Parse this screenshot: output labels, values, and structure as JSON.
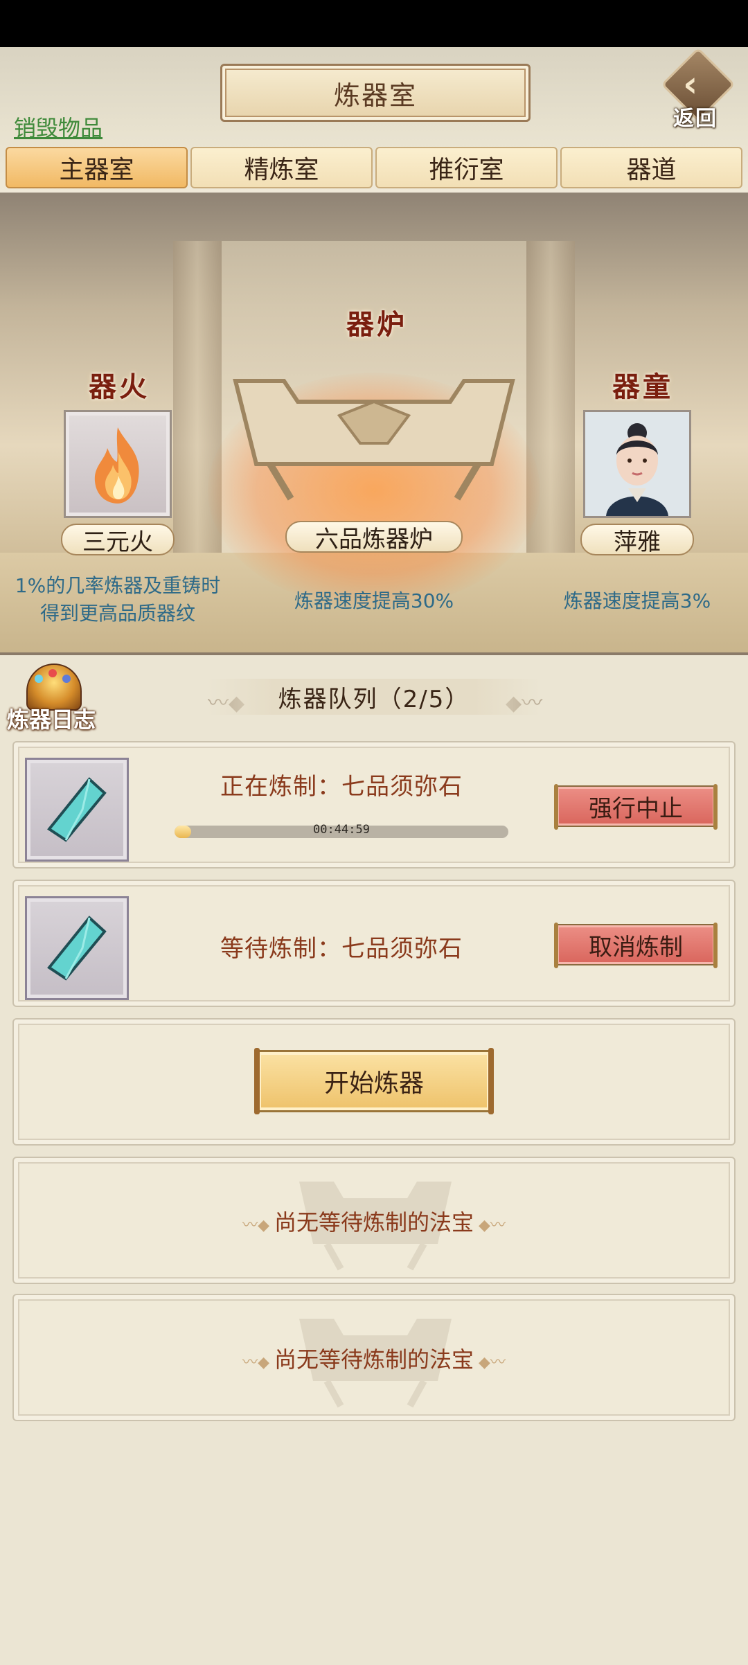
{
  "header": {
    "title": "炼器室",
    "back_label": "返回",
    "destroy_link": "销毁物品"
  },
  "tabs": [
    {
      "label": "主器室",
      "active": true
    },
    {
      "label": "精炼室",
      "active": false
    },
    {
      "label": "推衍室",
      "active": false
    },
    {
      "label": "器道",
      "active": false
    }
  ],
  "scene": {
    "fire": {
      "heading": "器火",
      "name": "三元火",
      "desc_line1": "1%的几率炼器及重铸时",
      "desc_line2": "得到更高品质器纹"
    },
    "furnace": {
      "heading": "器炉",
      "name": "六品炼器炉",
      "desc": "炼器速度提高30%"
    },
    "assistant": {
      "heading": "器童",
      "name": "萍雅",
      "desc": "炼器速度提高3%"
    }
  },
  "queue": {
    "log_label": "炼器日志",
    "title": "炼器队列（2/5）",
    "active": {
      "text": "正在炼制：七品须弥石",
      "time": "00:44:59",
      "progress": 0.05,
      "button": "强行中止"
    },
    "waiting": {
      "text": "等待炼制：七品须弥石",
      "button": "取消炼制"
    },
    "start_button": "开始炼器",
    "empty_slots": [
      "尚无等待炼制的法宝",
      "尚无等待炼制的法宝"
    ]
  },
  "colors": {
    "accent_red": "#d9655c",
    "tab_active": "#f1b964",
    "text_brown": "#8a3a1c",
    "desc_blue": "#2e6a88",
    "link_green": "#3f8a3a"
  },
  "icons": {
    "item": "crystal-icon",
    "fire": "flame-icon",
    "back": "back-arrow-icon",
    "log": "treasure-pot-icon"
  }
}
